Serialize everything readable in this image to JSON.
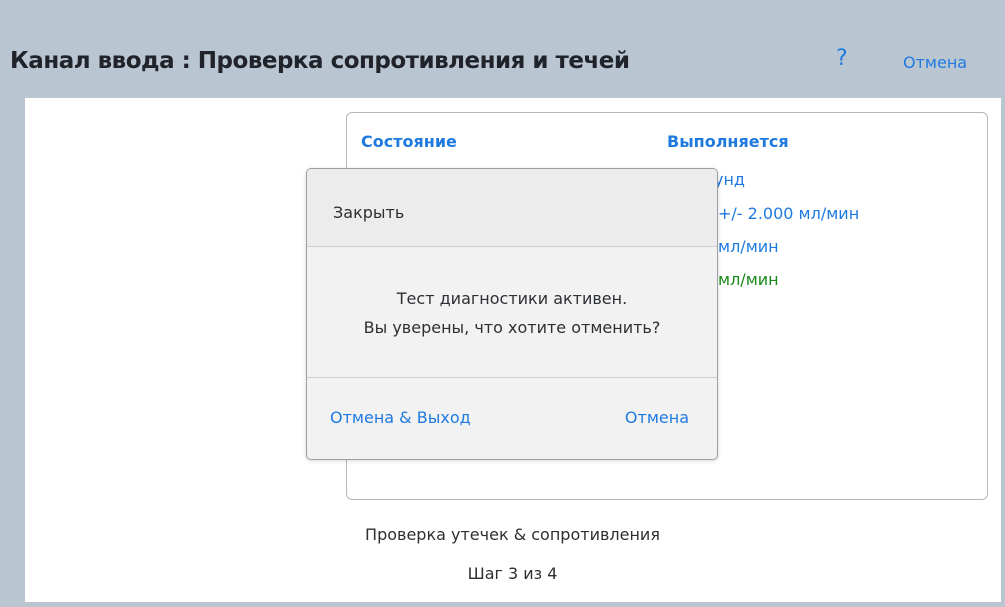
{
  "header": {
    "title": "Канал ввода : Проверка сопротивления и течей",
    "help_label": "?",
    "cancel_label": "Отмена"
  },
  "status_panel": {
    "label": "Состояние",
    "value": "Выполняется",
    "rows": [
      {
        "text": "унд"
      },
      {
        "text": "+/- 2.000 мл/мин"
      },
      {
        "text": "мл/мин"
      },
      {
        "text": "мл/мин"
      }
    ]
  },
  "step": {
    "name": "Проверка утечек & сопротивления",
    "counter": "Шаг 3 из 4"
  },
  "dialog": {
    "close_label": "Закрыть",
    "message_line1": "Тест диагностики активен.",
    "message_line2": "Вы уверены, что хотите отменить?",
    "exit_button": "Отмена & Выход",
    "cancel_button": "Отмена"
  },
  "colors": {
    "accent": "#1f7ae0",
    "ok_green": "#1b8a1b",
    "header_bg": "#b9c6d2"
  }
}
